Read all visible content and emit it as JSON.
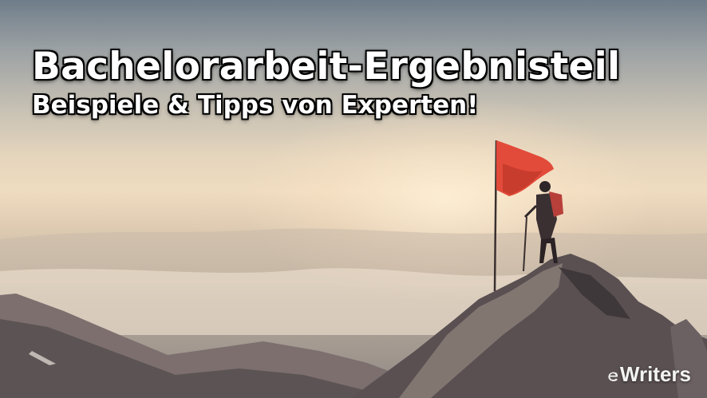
{
  "hero": {
    "title": "Bachelorarbeit-Ergebnisteil",
    "subtitle": "Beispiele & Tipps von Experten!"
  },
  "logo": {
    "text": "Writers",
    "icon": "e-letter-logo-icon"
  },
  "colors": {
    "flag": "#e24a3a",
    "title_text": "#ffffff",
    "mountain_dark": "#4e4649"
  }
}
